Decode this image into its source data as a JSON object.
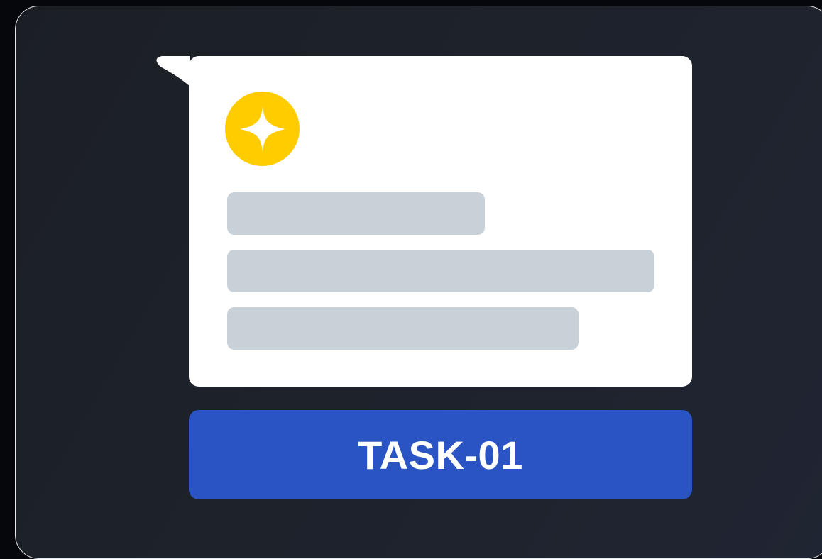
{
  "card": {
    "icon": "sparkle-icon",
    "accent_color": "#ffcc00",
    "skeleton_color": "#c9d1d8"
  },
  "task": {
    "label": "TASK-01",
    "color": "#2a54c3"
  }
}
